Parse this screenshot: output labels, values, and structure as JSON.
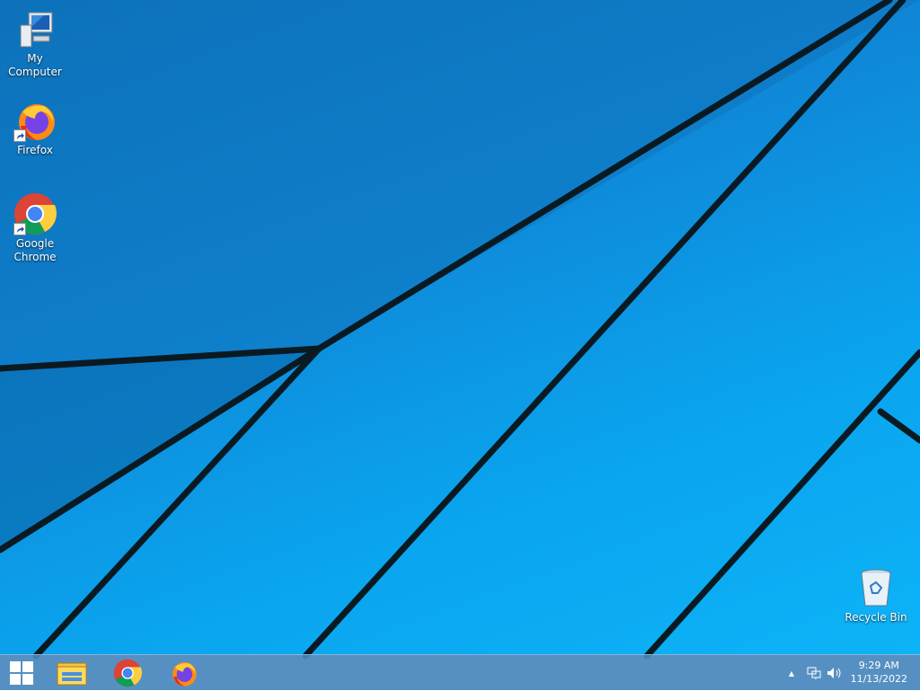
{
  "desktop": {
    "icons": [
      {
        "label": "My Computer",
        "icon": "computer-icon"
      },
      {
        "label": "Firefox",
        "icon": "firefox-icon"
      },
      {
        "label": "Google Chrome",
        "icon": "chrome-icon"
      },
      {
        "label": "Recycle Bin",
        "icon": "recycle-bin-icon"
      }
    ],
    "wallpaper_color": "#0aa5ef"
  },
  "taskbar": {
    "pinned": [
      {
        "icon": "start-icon"
      },
      {
        "icon": "file-explorer-icon"
      },
      {
        "icon": "chrome-icon"
      },
      {
        "icon": "firefox-icon"
      }
    ],
    "tray": {
      "show_hidden": "▲",
      "time": "9:29 AM",
      "date": "11/13/2022"
    }
  }
}
